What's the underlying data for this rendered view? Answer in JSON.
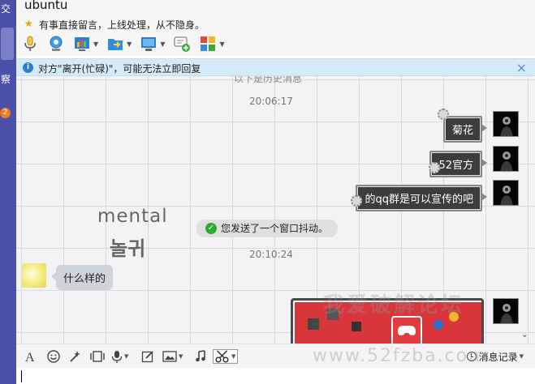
{
  "sidebar": {
    "tab_top": "交",
    "tab_mid": "察",
    "badge": "2",
    "accent": "#4a4fa8"
  },
  "header": {
    "title": "ubuntu",
    "status": "有事直接留言，上线处理，从不隐身。",
    "toolbar": [
      {
        "icon": "microphone-icon"
      },
      {
        "icon": "video-camera-icon"
      },
      {
        "icon": "app-chart-icon"
      },
      {
        "icon": "send-file-icon"
      },
      {
        "icon": "remote-desktop-icon"
      },
      {
        "icon": "add-chat-icon"
      },
      {
        "icon": "app-grid-icon"
      }
    ]
  },
  "notice": {
    "text": "对方\"离开(忙碌)\"，可能无法立即回复",
    "close": "×"
  },
  "chat": {
    "history_tip": "以下是历史消息",
    "messages": [
      {
        "time": "20:06:17"
      },
      {
        "text": "菊花",
        "side": "right"
      },
      {
        "text": "52官方",
        "side": "right"
      },
      {
        "text": "的qq群是可以宣传的吧",
        "side": "right"
      },
      {
        "system": "您发送了一个窗口抖动。"
      },
      {
        "time": "20:10:24"
      },
      {
        "text": "什么样的",
        "side": "left"
      }
    ],
    "watermark_en": "mental",
    "watermark_ko": "놀귀",
    "site_watermark_cn": "我爱破解论坛",
    "scroll_icon": "chevron-down-icon"
  },
  "input_bar": {
    "tools": [
      "font-icon",
      "emoji-icon",
      "magic-icon",
      "shake-icon",
      "voice-icon",
      "edit-icon",
      "image-icon",
      "music-icon",
      "screenshot-icon"
    ],
    "history_label": "消息记录",
    "site_watermark": "www.52fzba.com"
  }
}
